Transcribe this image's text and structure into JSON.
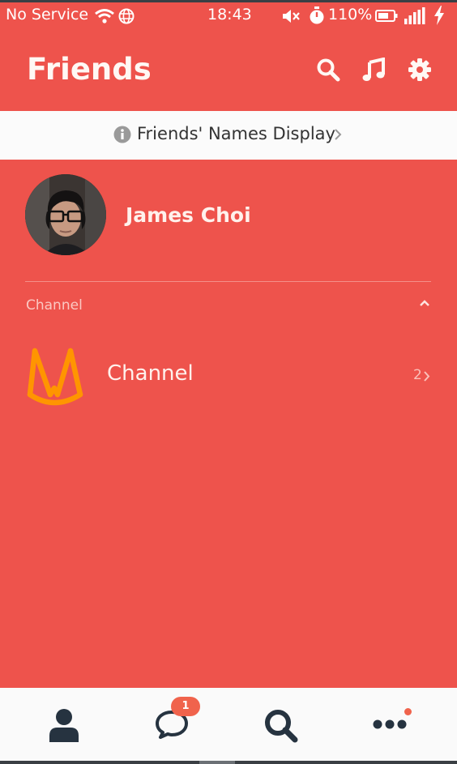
{
  "status_bar": {
    "carrier": "No Service",
    "time": "18:43",
    "battery_percent": "110%",
    "icons": [
      "wifi-icon",
      "globe-icon",
      "mute-icon",
      "timer-icon",
      "battery-icon",
      "signal-icon",
      "charging-bolt-icon"
    ]
  },
  "header": {
    "title": "Friends",
    "icons": [
      "search-icon",
      "music-icon",
      "gear-icon"
    ]
  },
  "banner": {
    "text": "Friends' Names Display",
    "icon": "info-icon"
  },
  "profile": {
    "name": "James Choi"
  },
  "channel_section": {
    "label": "Channel",
    "items": [
      {
        "label": "Channel",
        "count": "2"
      }
    ]
  },
  "bottom_nav": {
    "items": [
      {
        "icon": "person-icon"
      },
      {
        "icon": "chat-bubble-icon",
        "badge": "1"
      },
      {
        "icon": "search-icon"
      },
      {
        "icon": "more-icon"
      }
    ]
  },
  "colors": {
    "background": "#ee534c",
    "banner": "#fbfbfb",
    "nav_background": "#fafafa",
    "badge": "#f0634c",
    "channel_logo": "#ff9500",
    "nav_icons": "#263340"
  }
}
